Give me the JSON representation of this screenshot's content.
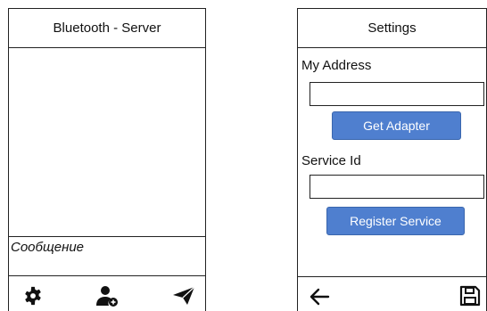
{
  "server_screen": {
    "title": "Bluetooth - Server",
    "message_placeholder": "Сообщение",
    "toolbar_icons": [
      "gear-icon",
      "user-add-icon",
      "send-icon"
    ]
  },
  "settings_screen": {
    "title": "Settings",
    "my_address_label": "My Address",
    "my_address_value": "",
    "get_adapter_label": "Get Adapter",
    "service_id_label": "Service Id",
    "service_id_value": "",
    "register_service_label": "Register Service",
    "toolbar_icons": [
      "back-arrow-icon",
      "save-icon"
    ]
  },
  "colors": {
    "button_fill": "#4f7fcf",
    "button_text": "#ffffff",
    "border": "#222222"
  }
}
